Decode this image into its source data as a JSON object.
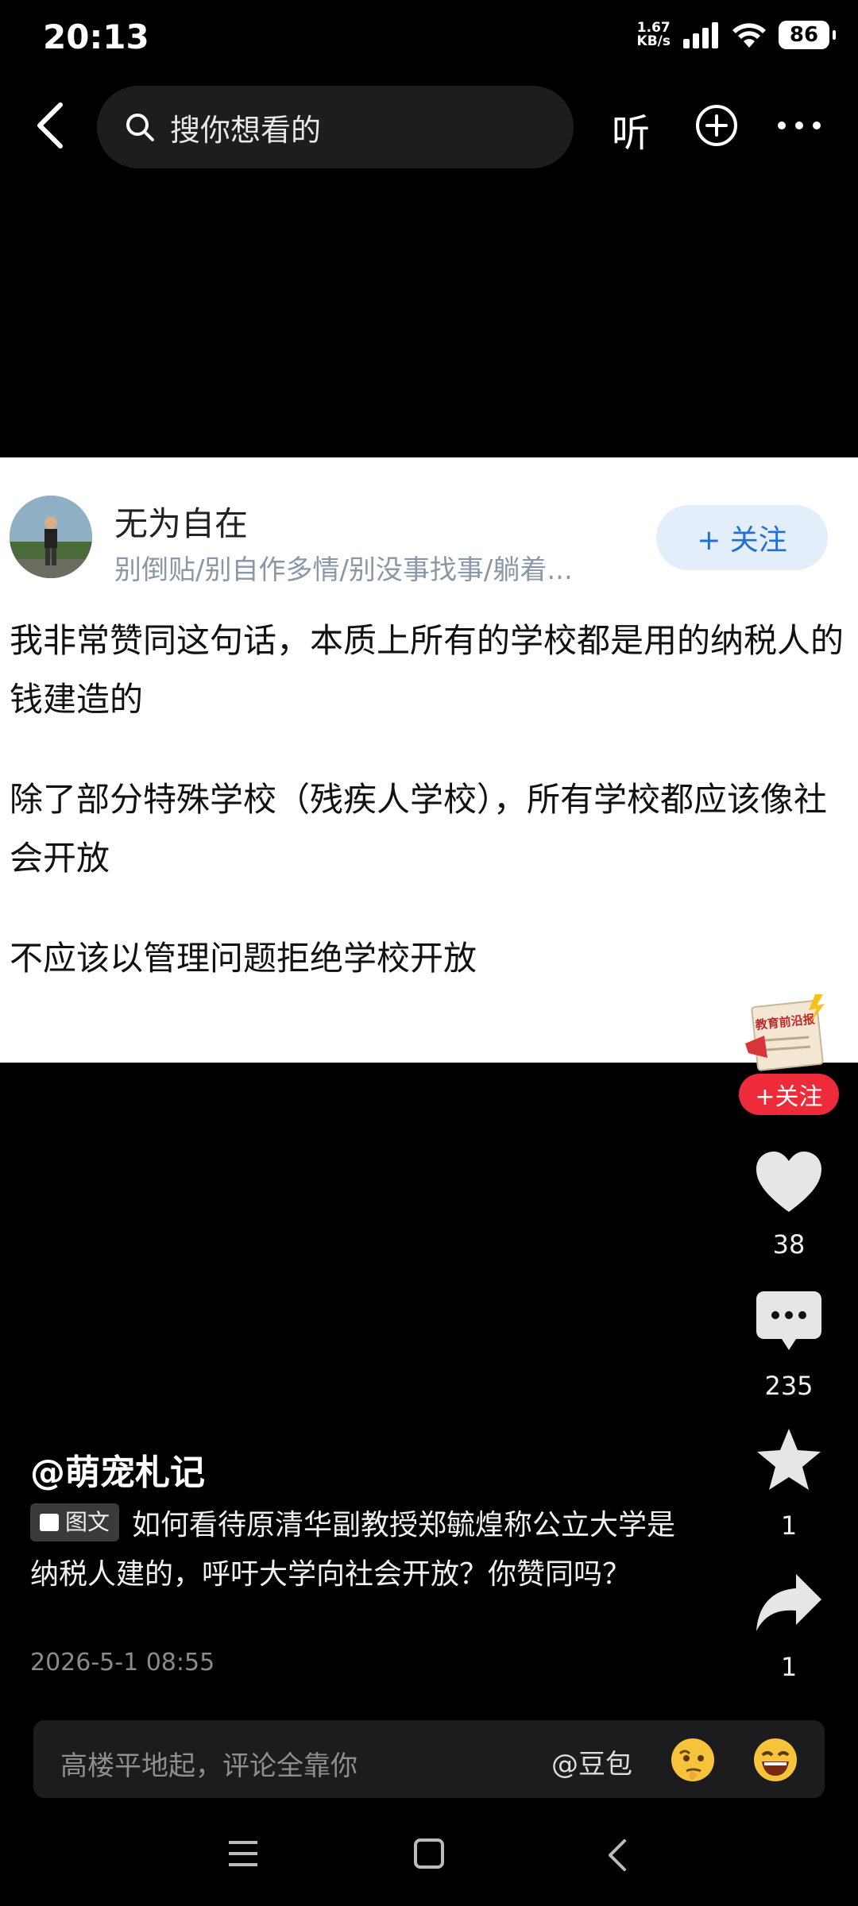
{
  "status_bar": {
    "time": "20:13",
    "net_speed_value": "1.67",
    "net_speed_unit": "KB/s",
    "battery": "86"
  },
  "top_nav": {
    "search_placeholder": "搜你想看的",
    "listen_label": "听"
  },
  "post": {
    "author_name": "无为自在",
    "author_bio": "别倒贴/别自作多情/别没事找事/躺着...",
    "follow_label": "+ 关注",
    "paragraphs": [
      "我非常赞同这句话，本质上所有的学校都是用的纳税人的钱建造的",
      "除了部分特殊学校（残疾人学校），所有学校都应该像社会开放",
      "不应该以管理问题拒绝学校开放"
    ]
  },
  "side_actions": {
    "account_badge_text": "教育前沿报",
    "follow_label": "+关注",
    "like_count": "38",
    "comment_count": "235",
    "favorite_count": "1",
    "share_count": "1"
  },
  "video_info": {
    "handle": "@萌宠札记",
    "tag_label": "图文",
    "description": "如何看待原清华副教授郑毓煌称公立大学是纳税人建的，呼吁大学向社会开放？你赞同吗？",
    "date": "2026-5-1 08:55"
  },
  "comment_bar": {
    "placeholder": "高楼平地起，评论全靠你",
    "mention": "@豆包"
  },
  "colors": {
    "follow_blue": "#1e6fd9",
    "follow_red": "#ee2b3a",
    "bio_gray": "#8a97a6"
  }
}
